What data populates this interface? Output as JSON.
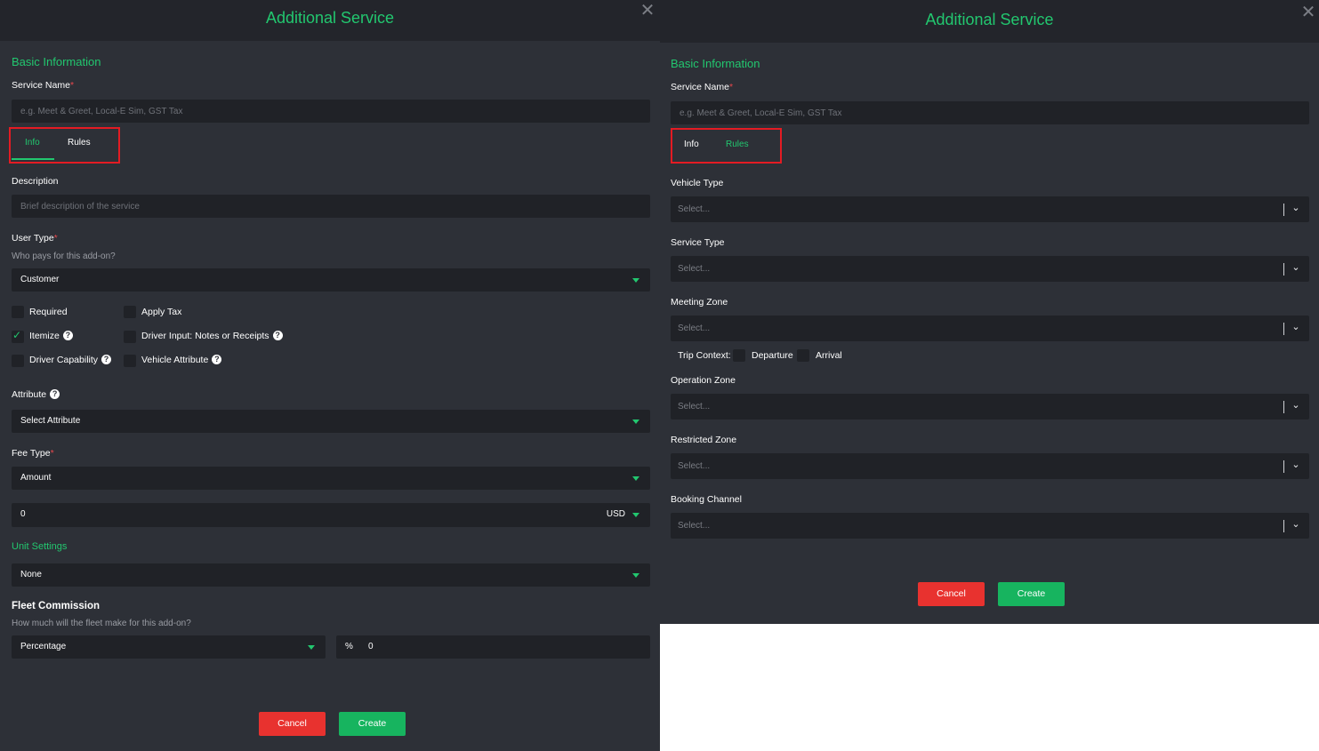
{
  "left": {
    "title": "Additional Service",
    "basic_info": "Basic Information",
    "service_name_label": "Service Name",
    "service_name_placeholder": "e.g. Meet & Greet, Local-E Sim, GST Tax",
    "tabs": [
      "Info",
      "Rules"
    ],
    "active_tab": "Info",
    "description_label": "Description",
    "description_placeholder": "Brief description of the service",
    "user_type_label": "User Type",
    "user_type_hint": "Who pays for this add-on?",
    "user_type_value": "Customer",
    "checkboxes": {
      "required": {
        "label": "Required",
        "checked": false
      },
      "apply_tax": {
        "label": "Apply Tax",
        "checked": false
      },
      "itemize": {
        "label": "Itemize",
        "checked": true
      },
      "driver_input": {
        "label": "Driver Input: Notes or Receipts",
        "checked": false
      },
      "driver_capability": {
        "label": "Driver Capability",
        "checked": false
      },
      "vehicle_attribute": {
        "label": "Vehicle Attribute",
        "checked": false
      }
    },
    "attribute_label": "Attribute",
    "attribute_value": "Select Attribute",
    "fee_type_label": "Fee Type",
    "fee_type_value": "Amount",
    "amount_value": "0",
    "currency": "USD",
    "unit_settings": "Unit Settings",
    "unit_value": "None",
    "fleet_commission_label": "Fleet Commission",
    "fleet_commission_hint": "How much will the fleet make for this add-on?",
    "commission_type": "Percentage",
    "commission_symbol": "%",
    "commission_value": "0",
    "cancel": "Cancel",
    "create": "Create"
  },
  "right": {
    "title": "Additional Service",
    "basic_info": "Basic Information",
    "service_name_label": "Service Name",
    "service_name_placeholder": "e.g. Meet & Greet, Local-E Sim, GST Tax",
    "tabs": [
      "Info",
      "Rules"
    ],
    "active_tab": "Rules",
    "vehicle_type_label": "Vehicle Type",
    "service_type_label": "Service Type",
    "meeting_zone_label": "Meeting Zone",
    "trip_context_label": "Trip Context:",
    "departure_label": "Departure",
    "arrival_label": "Arrival",
    "operation_zone_label": "Operation Zone",
    "restricted_zone_label": "Restricted Zone",
    "booking_channel_label": "Booking Channel",
    "select_placeholder": "Select...",
    "cancel": "Cancel",
    "create": "Create"
  },
  "colors": {
    "accent": "#22c76f",
    "panel_bg": "#2d3037",
    "header_bg": "#23252b",
    "field_bg": "#202227",
    "cancel": "#e8322f",
    "create": "#17b45f",
    "highlight": "#e31b23"
  },
  "icons": [
    "close-icon",
    "chevron-down-icon",
    "caret-down-icon",
    "help-icon",
    "check-icon"
  ]
}
